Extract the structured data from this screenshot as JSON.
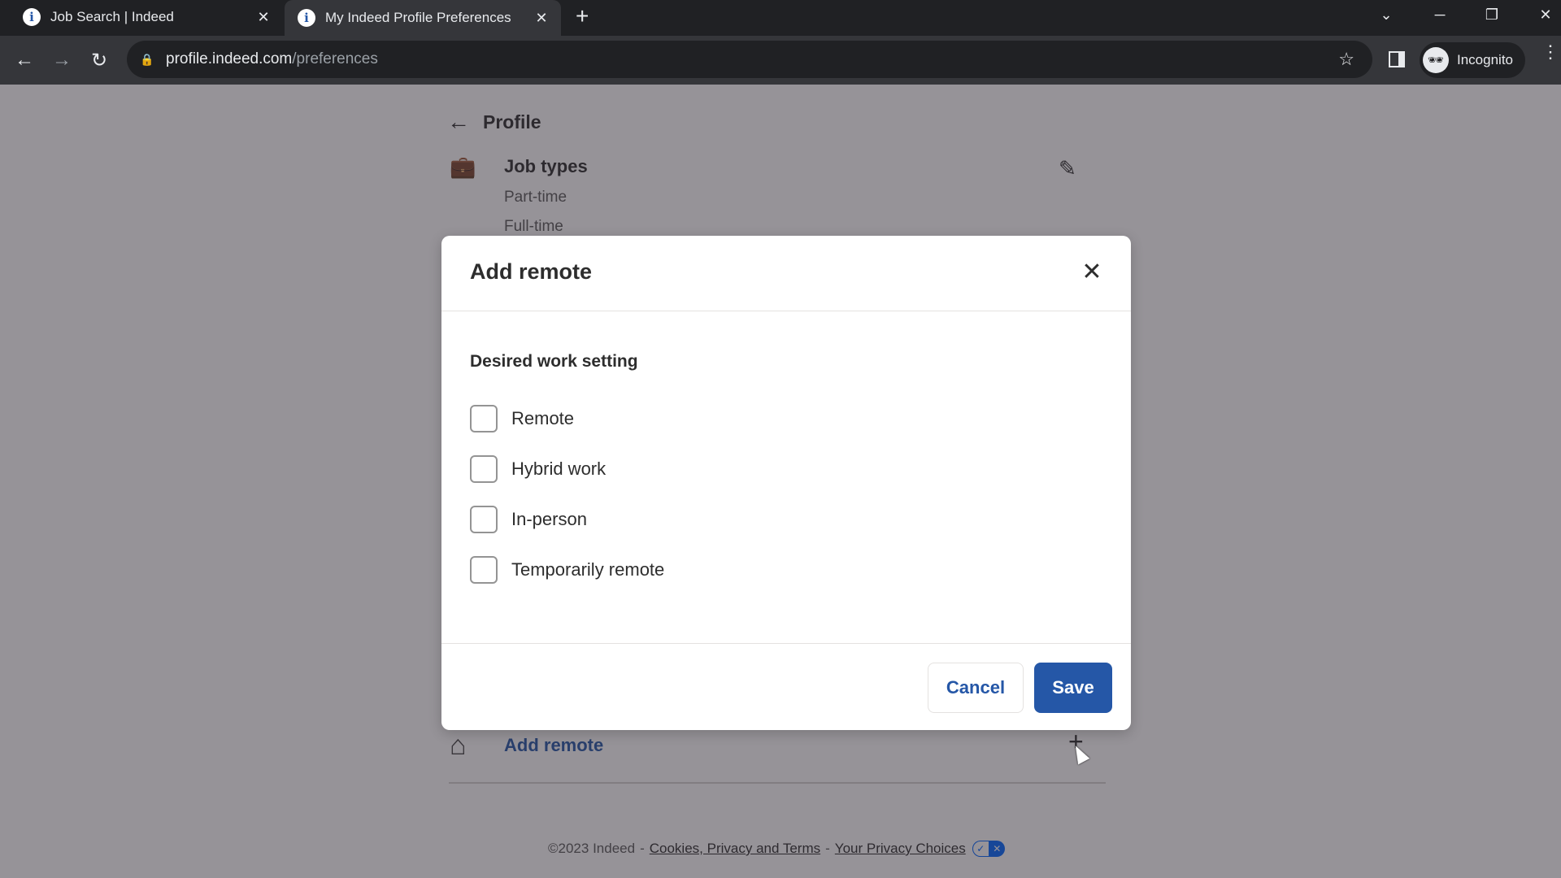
{
  "browser": {
    "tabs": [
      {
        "title": "Job Search | Indeed",
        "favicon": "indeed-favicon",
        "active": false
      },
      {
        "title": "My Indeed Profile Preferences",
        "favicon": "indeed-favicon",
        "active": true
      }
    ],
    "new_tab_label": "+",
    "url_host": "profile.indeed.com",
    "url_path": "/preferences",
    "profile_label": "Incognito",
    "icons": {
      "favicon": "i",
      "close": "✕",
      "back": "←",
      "forward": "→",
      "reload": "↻",
      "lock": "🔒",
      "star": "☆",
      "tab_search": "⌄",
      "minimize": "─",
      "restore": "❐",
      "win_close": "✕",
      "menu": "⋮",
      "incognito": "🕶"
    }
  },
  "page": {
    "back_label": "Profile",
    "back_arrow": "←",
    "job_types": {
      "title": "Job types",
      "values": [
        "Part-time",
        "Full-time"
      ],
      "icon": "💼",
      "edit_icon": "✎"
    },
    "add_remote_link": "Add remote",
    "home_icon": "⌂",
    "plus_icon": "+",
    "footer": {
      "copyright": "©2023 Indeed",
      "separator": "-",
      "link_terms": "Cookies, Privacy and Terms",
      "link_privacy": "Your Privacy Choices",
      "badge_check": "✓",
      "badge_x": "✕"
    }
  },
  "modal": {
    "title": "Add remote",
    "close_icon": "✕",
    "group_label": "Desired work setting",
    "options": [
      {
        "label": "Remote",
        "checked": false
      },
      {
        "label": "Hybrid work",
        "checked": false
      },
      {
        "label": "In-person",
        "checked": false
      },
      {
        "label": "Temporarily remote",
        "checked": false
      }
    ],
    "cancel_label": "Cancel",
    "save_label": "Save"
  },
  "colors": {
    "brand_blue": "#2557a7",
    "overlay": "#949299"
  }
}
